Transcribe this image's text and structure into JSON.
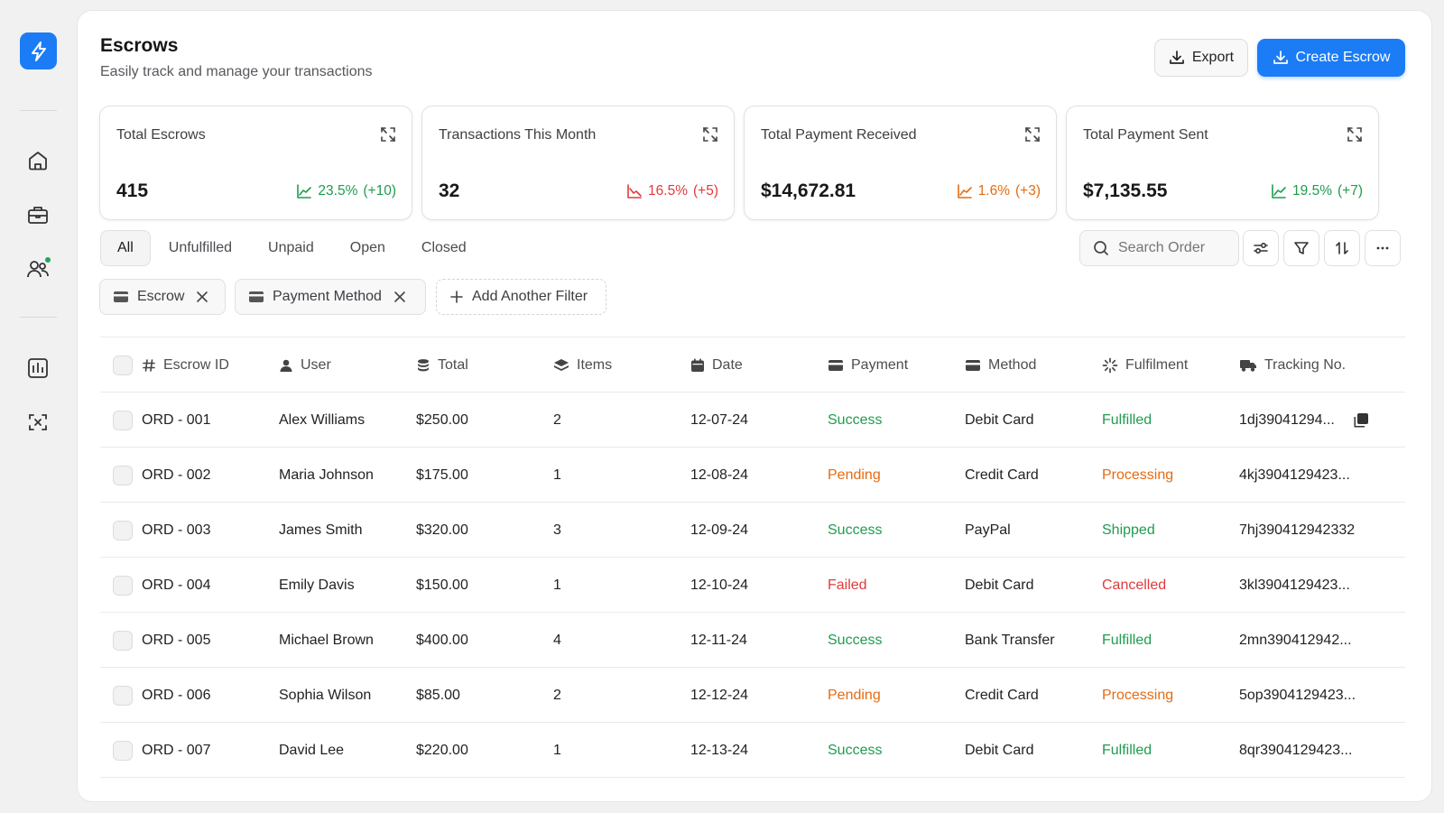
{
  "header": {
    "title": "Escrows",
    "subtitle": "Easily track and manage your transactions",
    "export_label": "Export",
    "create_label": "Create Escrow"
  },
  "stats": [
    {
      "label": "Total Escrows",
      "value": "415",
      "percent": "23.5%",
      "change": "(+10)",
      "trend": "up"
    },
    {
      "label": "Transactions This Month",
      "value": "32",
      "percent": "16.5%",
      "change": "(+5)",
      "trend": "down"
    },
    {
      "label": "Total Payment Received",
      "value": "$14,672.81",
      "percent": "1.6%",
      "change": "(+3)",
      "trend": "up-warn"
    },
    {
      "label": "Total Payment Sent",
      "value": "$7,135.55",
      "percent": "19.5%",
      "change": "(+7)",
      "trend": "up"
    }
  ],
  "tabs": [
    "All",
    "Unfulfilled",
    "Unpaid",
    "Open",
    "Closed"
  ],
  "search": {
    "placeholder": "Search Order"
  },
  "filters": {
    "chips": [
      "Escrow",
      "Payment Method"
    ],
    "add_label": "Add Another Filter"
  },
  "table": {
    "columns": [
      "Escrow ID",
      "User",
      "Total",
      "Items",
      "Date",
      "Payment",
      "Method",
      "Fulfilment",
      "Tracking No."
    ],
    "rows": [
      {
        "id": "ORD - 001",
        "user": "Alex Williams",
        "total": "$250.00",
        "items": "2",
        "date": "12-07-24",
        "payment": "Success",
        "method": "Debit Card",
        "fulfilment": "Fulfilled",
        "tracking": "1dj39041294..."
      },
      {
        "id": "ORD - 002",
        "user": "Maria Johnson",
        "total": "$175.00",
        "items": "1",
        "date": "12-08-24",
        "payment": "Pending",
        "method": "Credit Card",
        "fulfilment": "Processing",
        "tracking": "4kj3904129423..."
      },
      {
        "id": "ORD - 003",
        "user": "James Smith",
        "total": "$320.00",
        "items": "3",
        "date": "12-09-24",
        "payment": "Success",
        "method": "PayPal",
        "fulfilment": "Shipped",
        "tracking": "7hj390412942332"
      },
      {
        "id": "ORD - 004",
        "user": "Emily Davis",
        "total": "$150.00",
        "items": "1",
        "date": "12-10-24",
        "payment": "Failed",
        "method": "Debit Card",
        "fulfilment": "Cancelled",
        "tracking": "3kl3904129423..."
      },
      {
        "id": "ORD - 005",
        "user": "Michael Brown",
        "total": "$400.00",
        "items": "4",
        "date": "12-11-24",
        "payment": "Success",
        "method": "Bank Transfer",
        "fulfilment": "Fulfilled",
        "tracking": "2mn390412942..."
      },
      {
        "id": "ORD - 006",
        "user": "Sophia Wilson",
        "total": "$85.00",
        "items": "2",
        "date": "12-12-24",
        "payment": "Pending",
        "method": "Credit Card",
        "fulfilment": "Processing",
        "tracking": "5op3904129423..."
      },
      {
        "id": "ORD - 007",
        "user": "David Lee",
        "total": "$220.00",
        "items": "1",
        "date": "12-13-24",
        "payment": "Success",
        "method": "Debit Card",
        "fulfilment": "Fulfilled",
        "tracking": "8qr3904129423..."
      }
    ]
  },
  "colors": {
    "accent": "#1b7cf6",
    "success": "#1f9c4f",
    "pending": "#e56b12",
    "failed": "#e03b3b"
  }
}
